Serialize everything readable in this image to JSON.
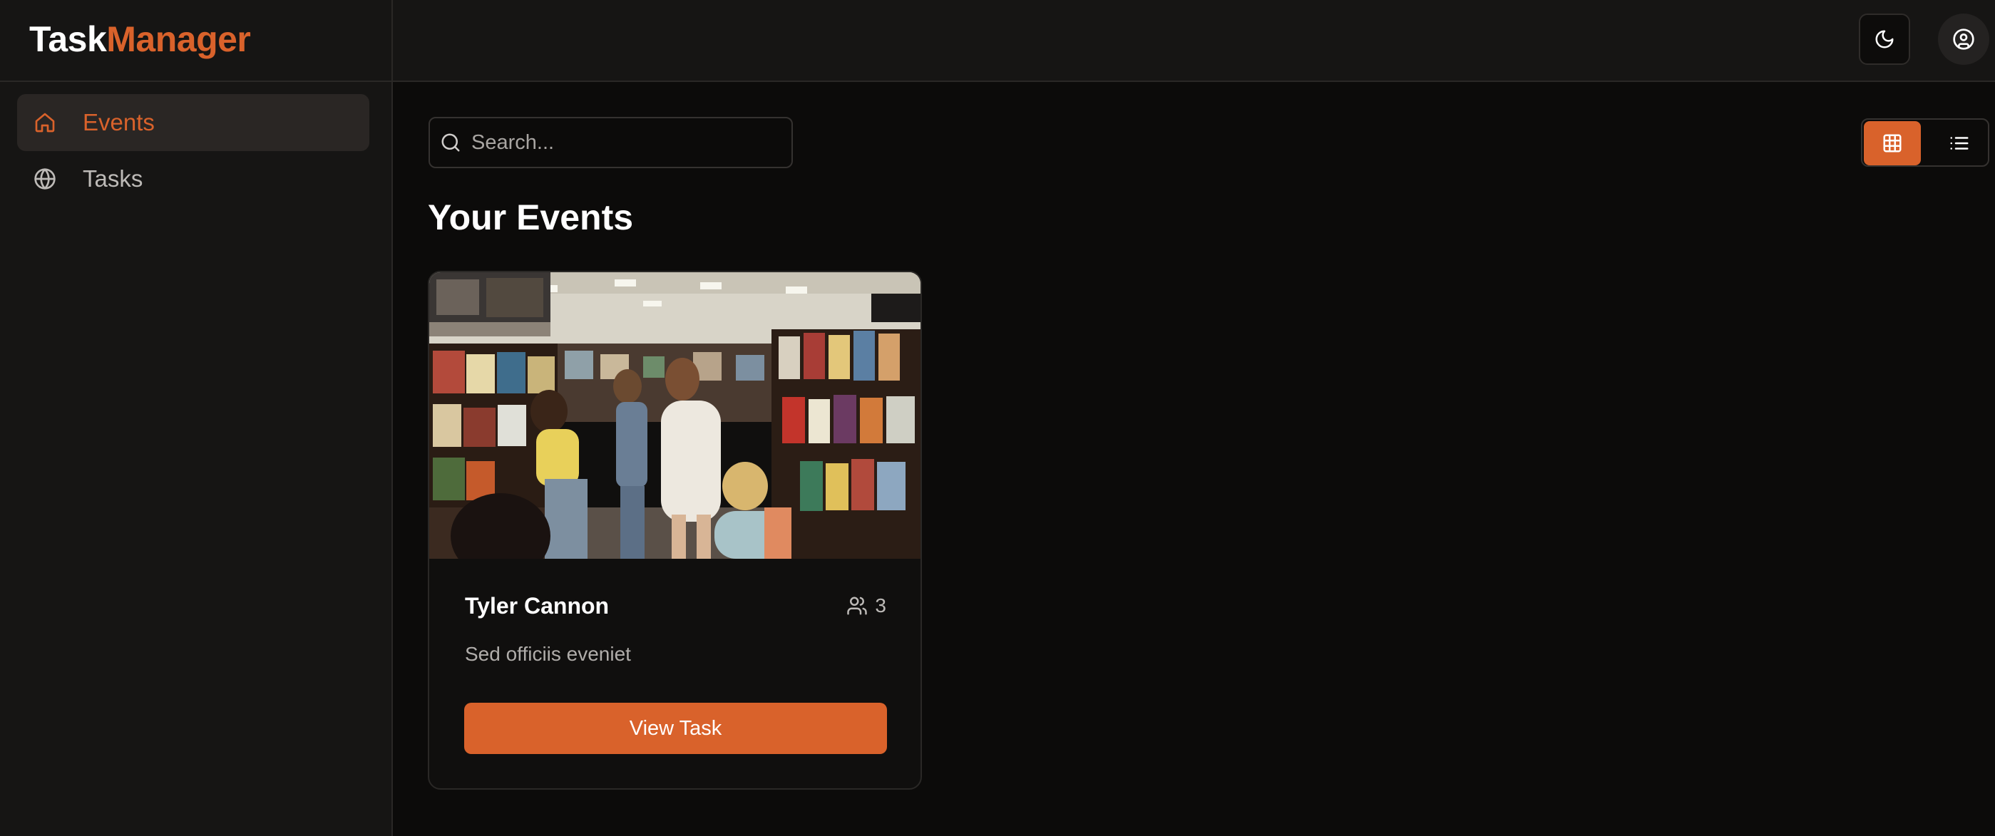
{
  "header": {
    "brand_part1": "Task",
    "brand_part2": "Manager",
    "theme_icon": "moon-icon",
    "user_icon": "user-circle-icon"
  },
  "sidebar": {
    "items": [
      {
        "label": "Events",
        "icon": "home-icon",
        "active": true
      },
      {
        "label": "Tasks",
        "icon": "globe-icon",
        "active": false
      }
    ]
  },
  "search": {
    "placeholder": "Search...",
    "value": ""
  },
  "view_toggle": {
    "selected": "grid",
    "options": [
      "grid",
      "list"
    ]
  },
  "page_title": "Your Events",
  "events": [
    {
      "title": "Tyler Cannon",
      "attendee_count": "3",
      "description": "Sed officiis eveniet",
      "button_label": "View Task",
      "image_desc_icon": "bookstore-photo"
    }
  ],
  "colors": {
    "accent": "#d9622b",
    "background": "#0c0b0a",
    "panel": "#161514"
  }
}
